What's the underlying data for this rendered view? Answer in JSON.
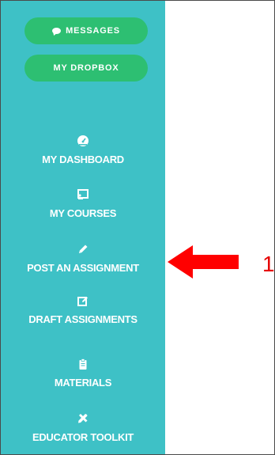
{
  "sidebar": {
    "top_buttons": {
      "messages": {
        "label": "MESSAGES",
        "icon": "chat-bubble-icon"
      },
      "dropbox": {
        "label": "MY DROPBOX"
      }
    },
    "items": [
      {
        "label": "MY DASHBOARD",
        "icon": "dashboard-gauge-icon"
      },
      {
        "label": "MY COURSES",
        "icon": "courses-presentation-icon"
      },
      {
        "label": "POST AN ASSIGNMENT",
        "icon": "pencil-icon"
      },
      {
        "label": "DRAFT ASSIGNMENTS",
        "icon": "edit-square-icon"
      },
      {
        "label": "MATERIALS",
        "icon": "clipboard-icon"
      },
      {
        "label": "EDUCATOR TOOLKIT",
        "icon": "tools-icon"
      }
    ],
    "colors": {
      "background": "#3ec1c6",
      "pill": "#2dbf72"
    }
  },
  "annotation": {
    "number": "1",
    "color": "#e60000",
    "arrow_icon": "red-arrow-left-icon"
  }
}
